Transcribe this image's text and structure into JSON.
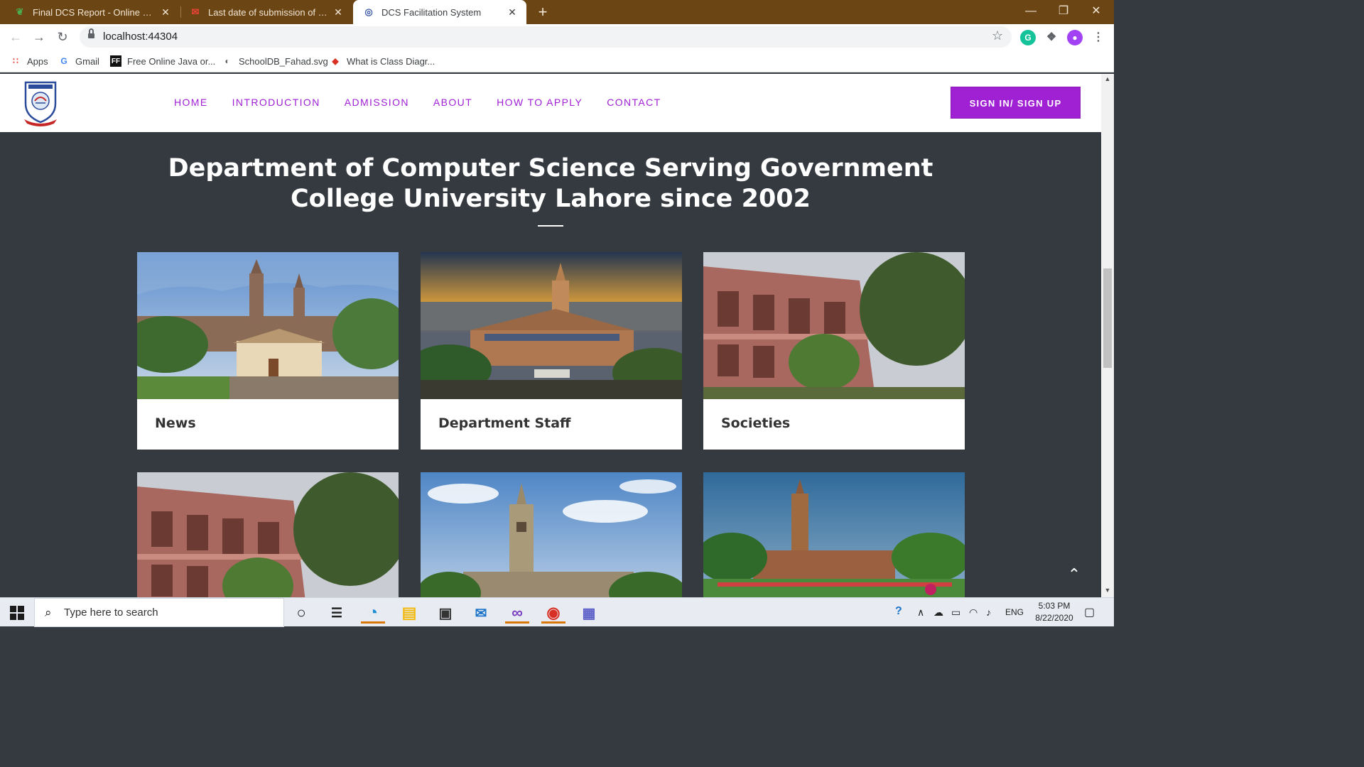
{
  "browser": {
    "tabs": [
      {
        "title": "Final DCS Report - Online LaTeX Editor",
        "active": false
      },
      {
        "title": "Last date of submission of FYP for",
        "active": false
      },
      {
        "title": "DCS Facilitation System",
        "active": true
      }
    ],
    "url": "localhost:44304",
    "bookmarks": [
      "Apps",
      "Gmail",
      "Free Online Java or...",
      "SchoolDB_Fahad.svg",
      "What is Class Diagr..."
    ]
  },
  "site": {
    "brand_color": "#a020d4",
    "nav": [
      "HOME",
      "INTRODUCTION",
      "ADMISSION",
      "ABOUT",
      "HOW TO APPLY",
      "CONTACT"
    ],
    "signin_label": "SIGN IN/ SIGN UP",
    "hero_title_line1": "Department of Computer Science Serving Government",
    "hero_title_line2": "College University Lahore since 2002",
    "cards": [
      "News",
      "Department Staff",
      "Societies",
      "",
      "",
      ""
    ]
  },
  "taskbar": {
    "search_placeholder": "Type here to search",
    "language": "ENG",
    "time": "5:03 PM",
    "date": "8/22/2020"
  }
}
